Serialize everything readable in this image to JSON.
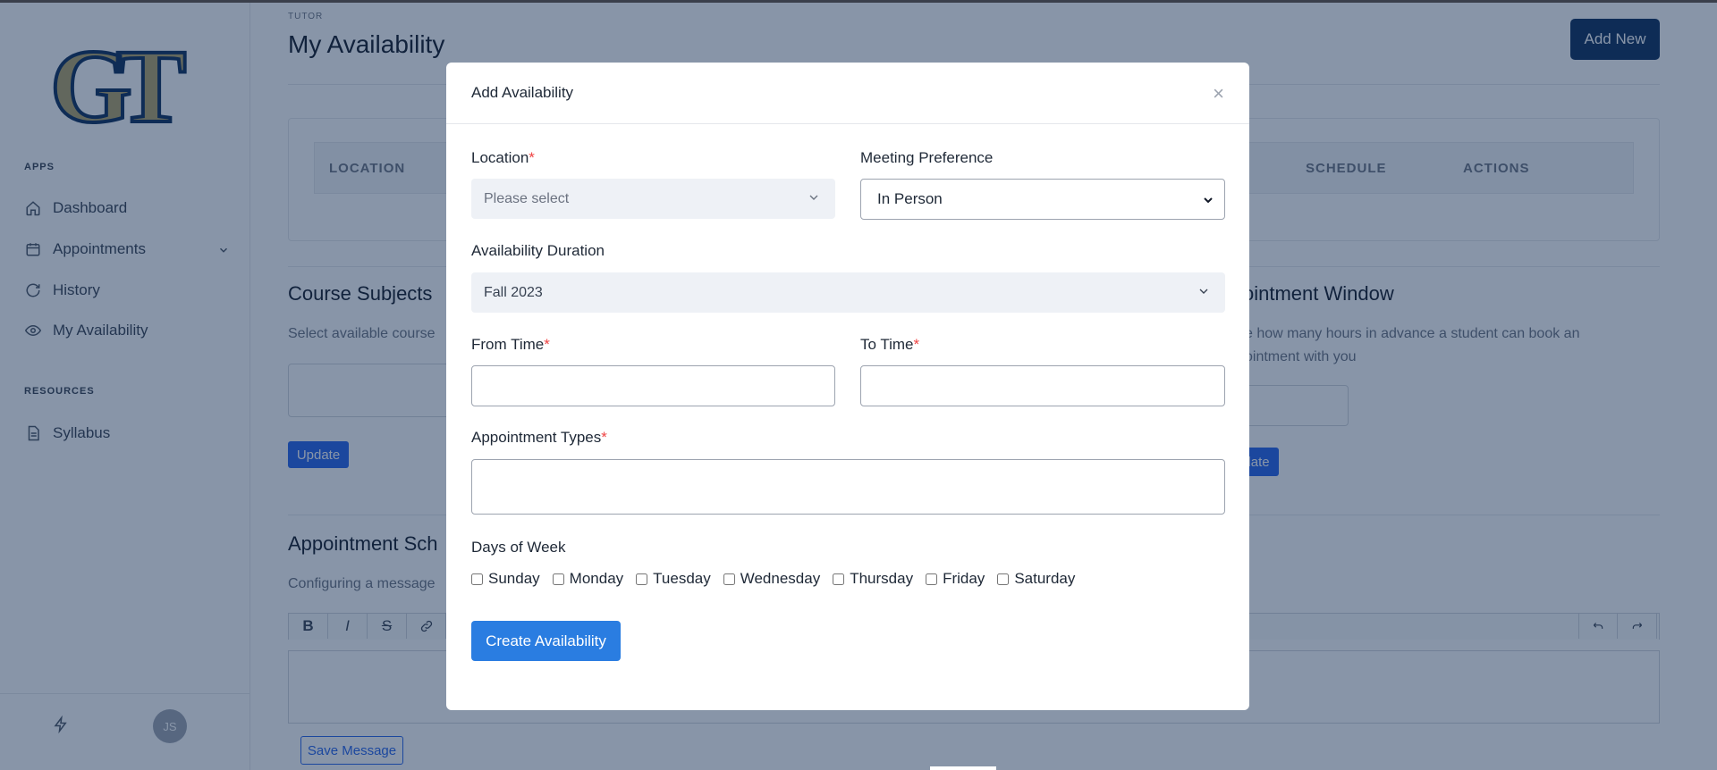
{
  "sidebar": {
    "apps_heading": "APPS",
    "resources_heading": "RESOURCES",
    "items": [
      {
        "label": "Dashboard",
        "icon": "home-icon"
      },
      {
        "label": "Appointments",
        "icon": "calendar-icon"
      },
      {
        "label": "History",
        "icon": "refresh-icon"
      },
      {
        "label": "My Availability",
        "icon": "eye-icon"
      }
    ],
    "resources": [
      {
        "label": "Syllabus",
        "icon": "document-icon"
      }
    ],
    "avatar_initials": "JS"
  },
  "header": {
    "supertitle": "TUTOR",
    "title": "My Availability",
    "add_new_label": "Add New"
  },
  "table": {
    "columns": [
      "LOCATION",
      "SCHEDULE",
      "ACTIONS"
    ]
  },
  "course_subjects": {
    "title": "Course Subjects",
    "subtitle": "Select available course",
    "update_label": "Update"
  },
  "appointment_window": {
    "title": "ointment Window",
    "subtitle_line1": "e how many hours in advance a student can book an",
    "subtitle_line2": "ointment with you",
    "update_label": "date"
  },
  "appointment_schedule": {
    "title": "Appointment Sch",
    "subtitle": "Configuring a message",
    "toolbar": [
      "B",
      "I",
      "S",
      "link"
    ],
    "save_label": "Save Message"
  },
  "modal": {
    "title": "Add Availability",
    "close_label": "×",
    "location": {
      "label": "Location",
      "required": "*",
      "placeholder": "Please select"
    },
    "meeting_preference": {
      "label": "Meeting Preference",
      "value": "In Person"
    },
    "availability_duration": {
      "label": "Availability Duration",
      "value": "Fall 2023"
    },
    "from_time": {
      "label": "From Time",
      "required": "*",
      "value": ""
    },
    "to_time": {
      "label": "To Time",
      "required": "*",
      "value": ""
    },
    "appointment_types": {
      "label": "Appointment Types",
      "required": "*",
      "value": ""
    },
    "days_of_week": {
      "label": "Days of Week",
      "days": [
        "Sunday",
        "Monday",
        "Tuesday",
        "Wednesday",
        "Thursday",
        "Friday",
        "Saturday"
      ]
    },
    "submit_label": "Create Availability"
  },
  "colors": {
    "primary_blue": "#2a7de1",
    "navy": "#0b2d5b",
    "logo_gold": "#b3a369",
    "required_red": "#ef4444"
  }
}
